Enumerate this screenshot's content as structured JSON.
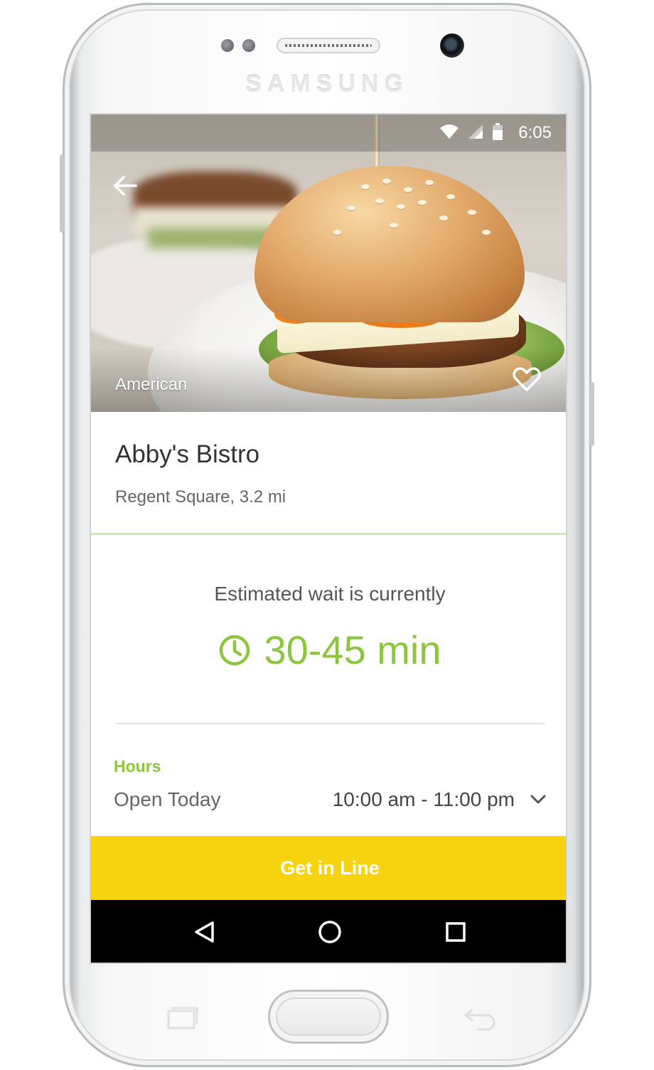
{
  "device": {
    "brand": "SAMSUNG"
  },
  "status_bar": {
    "time": "6:05",
    "icons": [
      "wifi-icon",
      "signal-icon",
      "battery-icon"
    ]
  },
  "hero": {
    "cuisine": "American",
    "favorite_icon": "heart-outline-icon",
    "back_icon": "arrow-left-icon"
  },
  "restaurant": {
    "name": "Abby's Bistro",
    "location": "Regent Square, 3.2 mi"
  },
  "wait": {
    "label": "Estimated wait is currently",
    "time": "30-45 min",
    "icon": "clock-icon"
  },
  "hours": {
    "label": "Hours",
    "day": "Open Today",
    "range": "10:00 am - 11:00 pm",
    "expand_icon": "chevron-down-icon"
  },
  "cta": {
    "label": "Get in Line"
  },
  "nav_bar": {
    "back_icon": "triangle-back-icon",
    "home_icon": "circle-home-icon",
    "recents_icon": "square-recents-icon"
  },
  "colors": {
    "accent_green": "#8cc63f",
    "cta_yellow": "#f6d20f",
    "nav_black": "#000000"
  }
}
